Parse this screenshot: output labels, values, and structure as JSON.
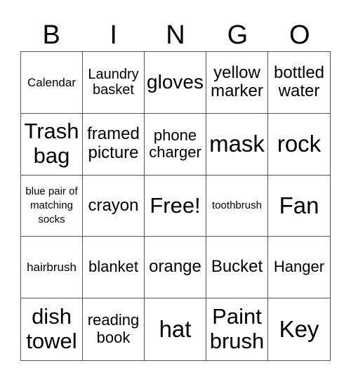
{
  "header": [
    "B",
    "I",
    "N",
    "G",
    "O"
  ],
  "cells": [
    "Calendar",
    "Laundry basket",
    "gloves",
    "yellow marker",
    "bottled water",
    "Trash bag",
    "framed picture",
    "phone charger",
    "mask",
    "rock",
    "blue pair of matching socks",
    "crayon",
    "Free!",
    "toothbrush",
    "Fan",
    "hairbrush",
    "blanket",
    "orange",
    "Bucket",
    "Hanger",
    "dish towel",
    "reading book",
    "hat",
    "Paint brush",
    "Key"
  ]
}
